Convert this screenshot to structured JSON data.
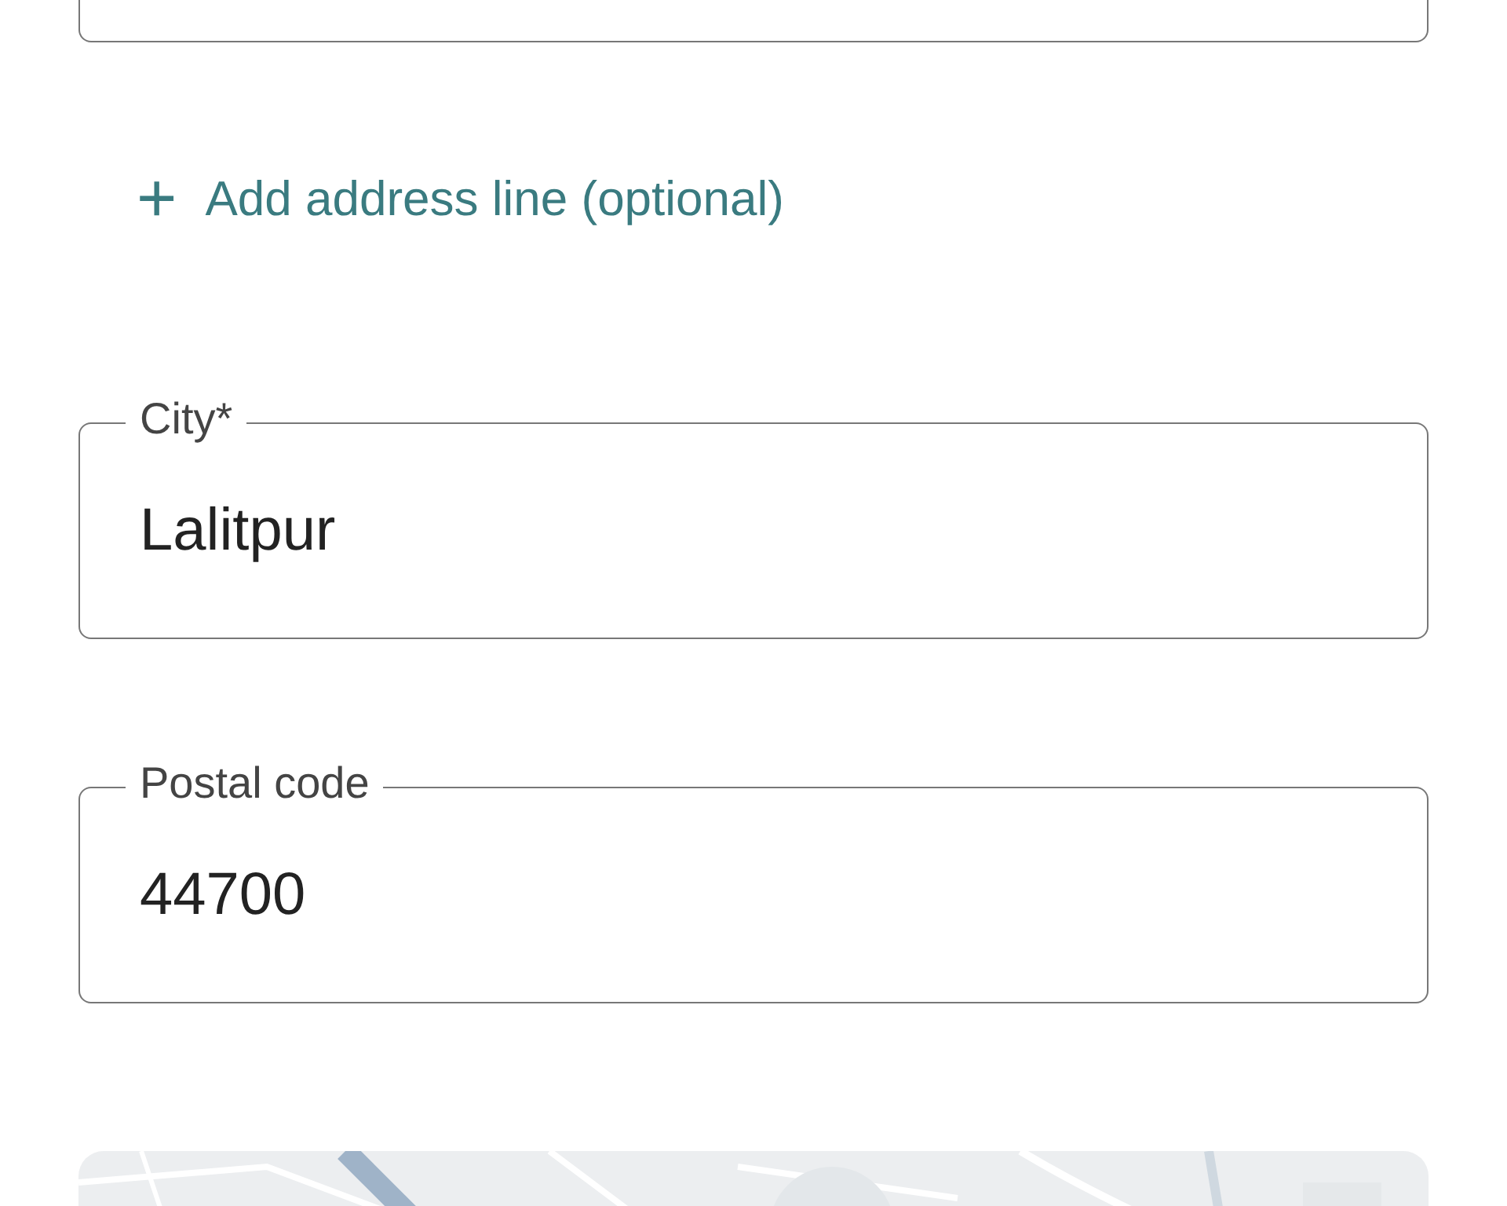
{
  "add_address_line": {
    "icon": "+",
    "label": "Add address line (optional)"
  },
  "fields": [
    {
      "label": "City*",
      "value": "Lalitpur"
    },
    {
      "label": "Postal code",
      "value": "44700"
    }
  ]
}
